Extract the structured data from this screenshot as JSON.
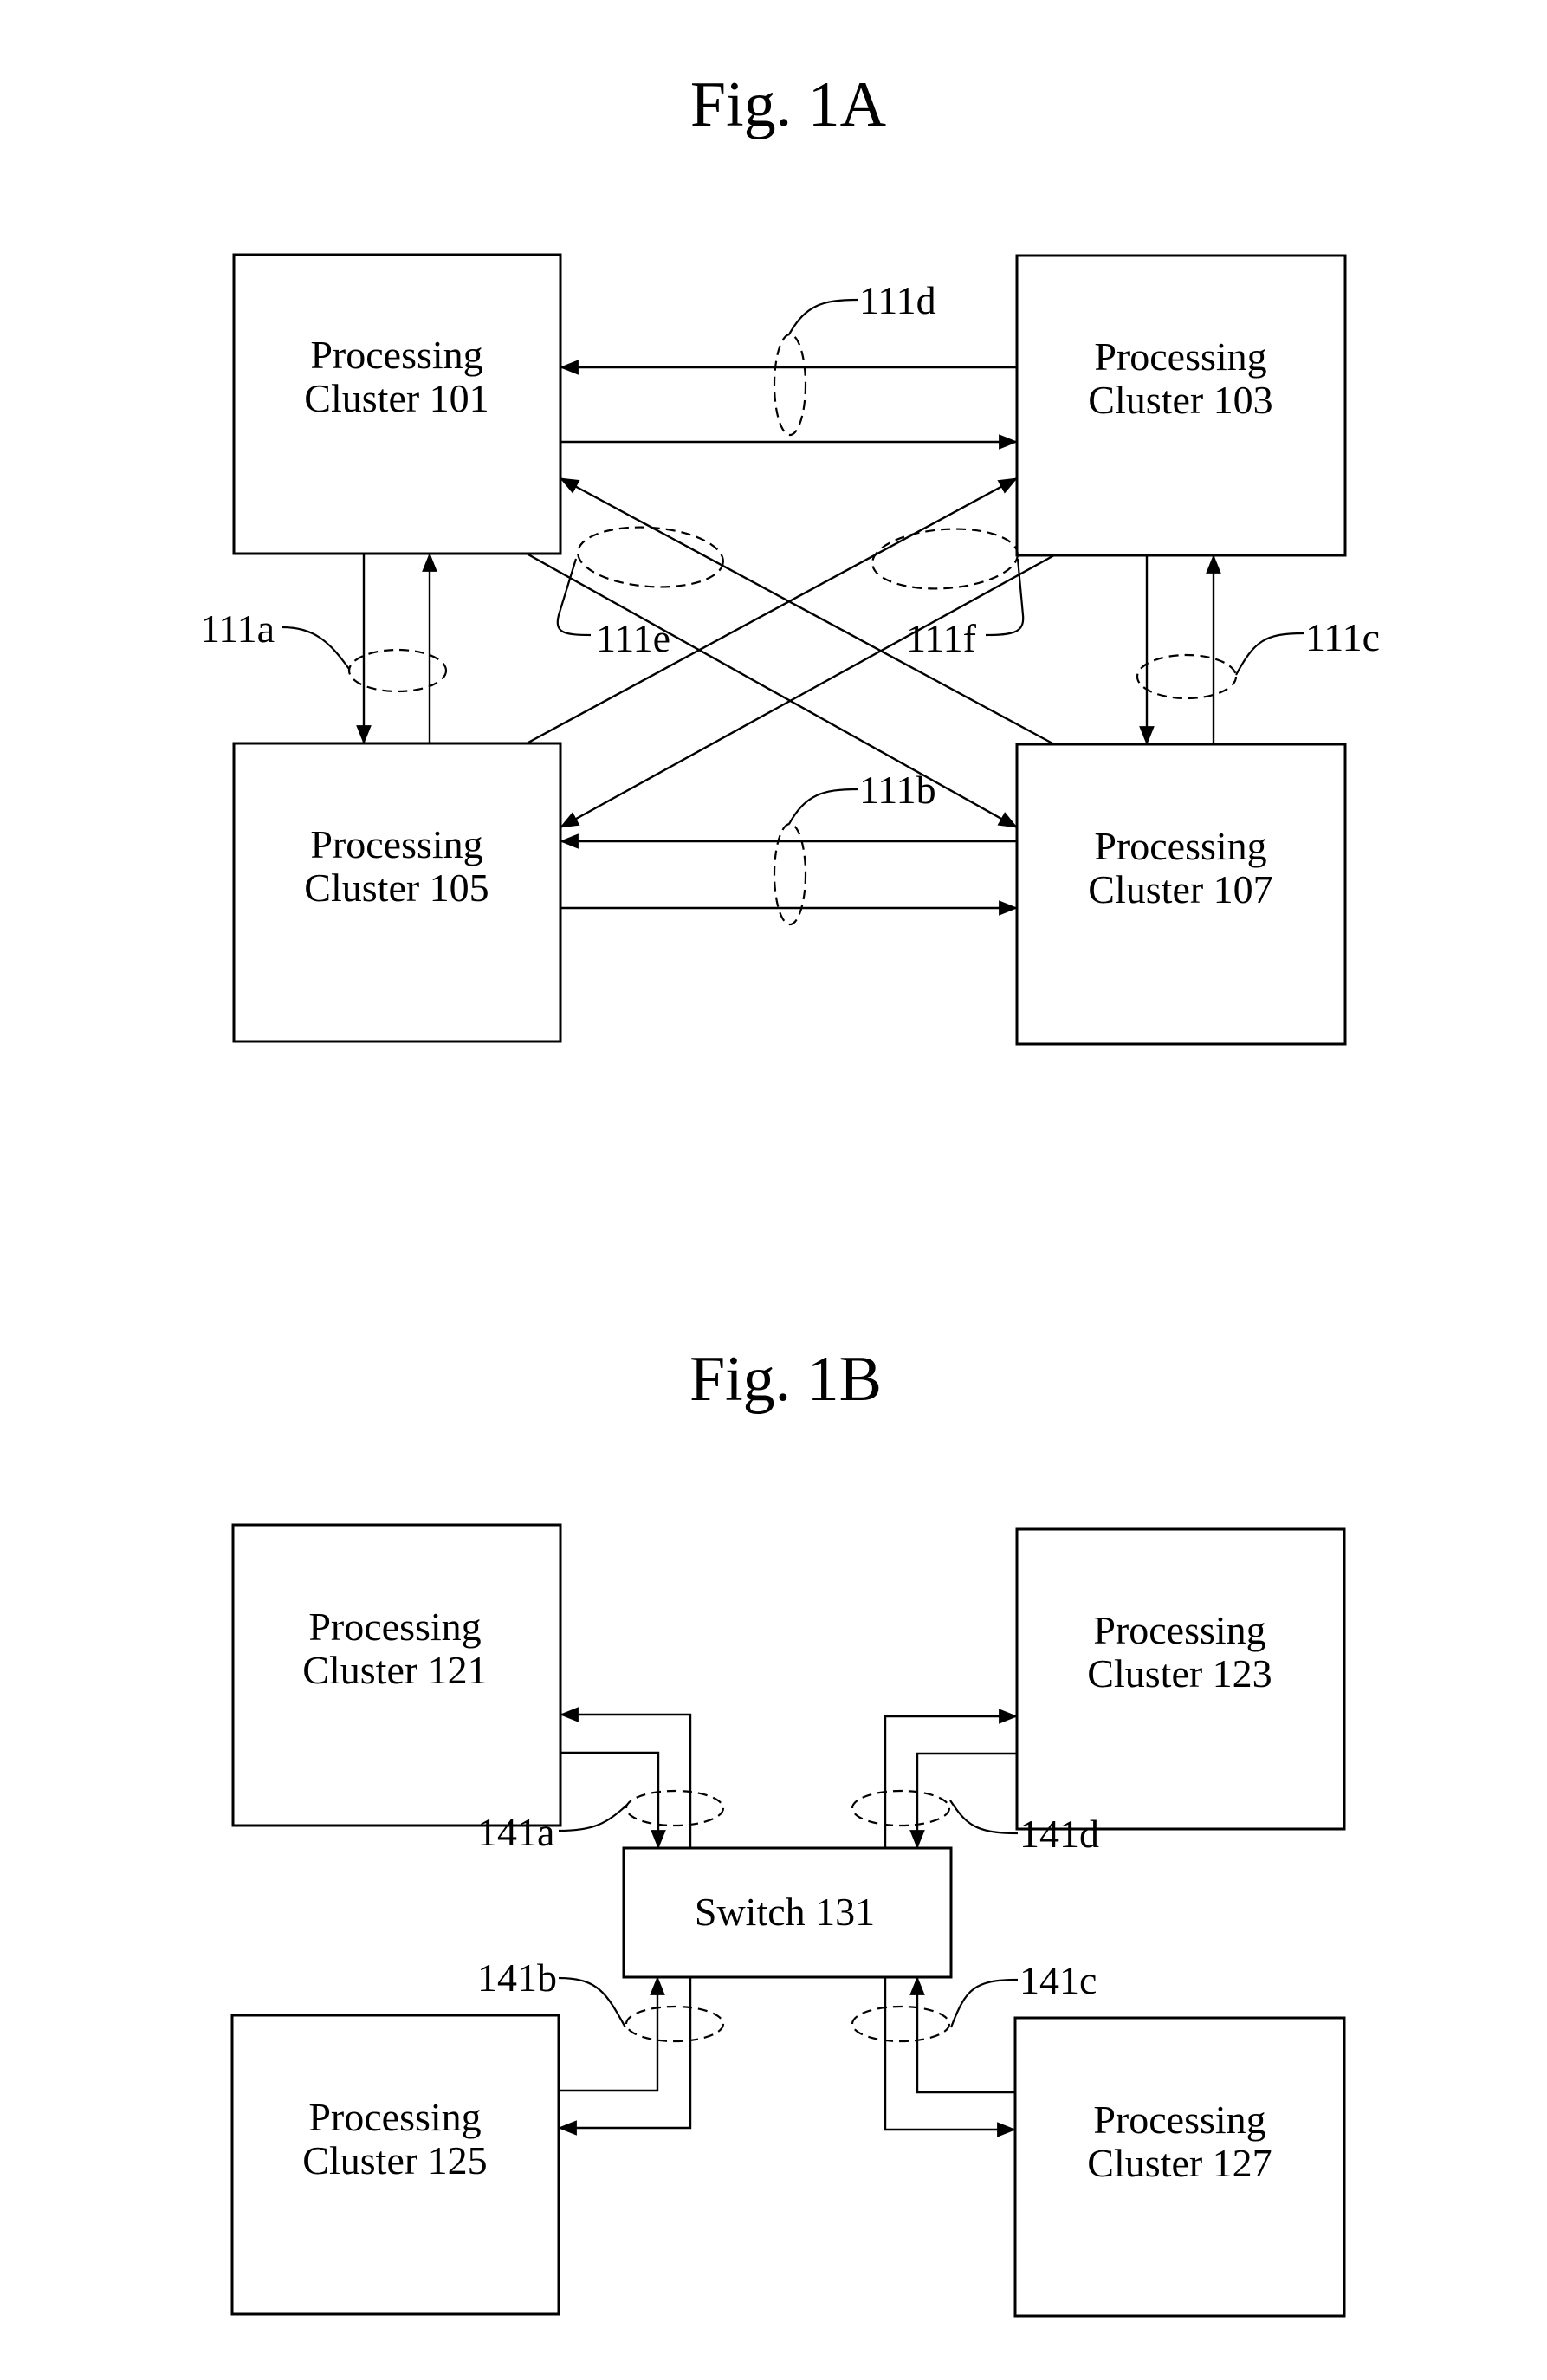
{
  "figures": [
    {
      "id": "1A",
      "title": "Fig. 1A",
      "nodes": [
        {
          "id": "101",
          "label_line1": "Processing",
          "label_line2": "Cluster 101"
        },
        {
          "id": "103",
          "label_line1": "Processing",
          "label_line2": "Cluster 103"
        },
        {
          "id": "105",
          "label_line1": "Processing",
          "label_line2": "Cluster 105"
        },
        {
          "id": "107",
          "label_line1": "Processing",
          "label_line2": "Cluster 107"
        }
      ],
      "links": [
        {
          "ref": "111a",
          "label": "111a",
          "connects": [
            "101",
            "105"
          ],
          "directions": [
            "101->105",
            "105->101"
          ]
        },
        {
          "ref": "111b",
          "label": "111b",
          "connects": [
            "105",
            "107"
          ],
          "directions": [
            "107->105",
            "105->107"
          ]
        },
        {
          "ref": "111c",
          "label": "111c",
          "connects": [
            "103",
            "107"
          ],
          "directions": [
            "103->107",
            "107->103"
          ]
        },
        {
          "ref": "111d",
          "label": "111d",
          "connects": [
            "101",
            "103"
          ],
          "directions": [
            "103->101",
            "101->103"
          ]
        },
        {
          "ref": "111e",
          "label": "111e",
          "connects": [
            "101",
            "107"
          ],
          "directions": [
            "101->107",
            "107->101"
          ]
        },
        {
          "ref": "111f",
          "label": "111f",
          "connects": [
            "103",
            "105"
          ],
          "directions": [
            "105->103",
            "103->105"
          ]
        }
      ]
    },
    {
      "id": "1B",
      "title": "Fig. 1B",
      "nodes": [
        {
          "id": "121",
          "label_line1": "Processing",
          "label_line2": "Cluster 121"
        },
        {
          "id": "123",
          "label_line1": "Processing",
          "label_line2": "Cluster 123"
        },
        {
          "id": "125",
          "label_line1": "Processing",
          "label_line2": "Cluster 125"
        },
        {
          "id": "127",
          "label_line1": "Processing",
          "label_line2": "Cluster 127"
        },
        {
          "id": "131",
          "label_line1": "Switch 131",
          "label_line2": ""
        }
      ],
      "links": [
        {
          "ref": "141a",
          "label": "141a",
          "connects": [
            "121",
            "131"
          ],
          "directions": [
            "131->121",
            "121->131"
          ]
        },
        {
          "ref": "141b",
          "label": "141b",
          "connects": [
            "125",
            "131"
          ],
          "directions": [
            "125->131",
            "131->125"
          ]
        },
        {
          "ref": "141c",
          "label": "141c",
          "connects": [
            "127",
            "131"
          ],
          "directions": [
            "127->131",
            "131->127"
          ]
        },
        {
          "ref": "141d",
          "label": "141d",
          "connects": [
            "123",
            "131"
          ],
          "directions": [
            "131->123",
            "123->131"
          ]
        }
      ]
    }
  ]
}
